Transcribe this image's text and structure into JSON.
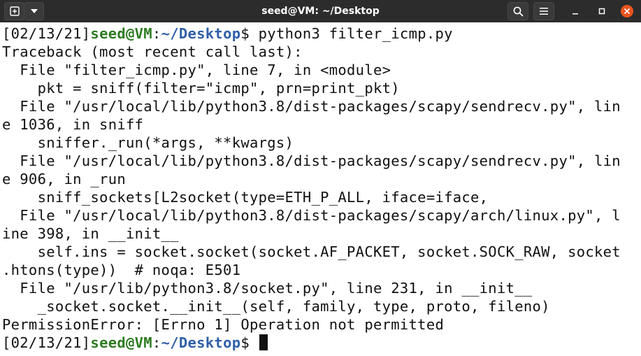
{
  "window": {
    "title": "seed@VM: ~/Desktop",
    "icons": {
      "new_tab": "new-tab-icon",
      "menu_dropdown": "chevron-down-icon",
      "search": "search-icon",
      "hamburger": "hamburger-menu-icon",
      "minimize": "minimize-icon",
      "maximize": "maximize-icon",
      "close": "close-icon"
    }
  },
  "prompt": {
    "date": "[02/13/21]",
    "user_host": "seed@VM",
    "separator": ":",
    "path": "~/Desktop",
    "symbol": "$ "
  },
  "terminal": {
    "command": "python3 filter_icmp.py",
    "output_lines": [
      "Traceback (most recent call last):",
      "  File \"filter_icmp.py\", line 7, in <module>",
      "    pkt = sniff(filter=\"icmp\", prn=print_pkt)",
      "  File \"/usr/local/lib/python3.8/dist-packages/scapy/sendrecv.py\", lin",
      "e 1036, in sniff",
      "    sniffer._run(*args, **kwargs)",
      "  File \"/usr/local/lib/python3.8/dist-packages/scapy/sendrecv.py\", lin",
      "e 906, in _run",
      "    sniff_sockets[L2socket(type=ETH_P_ALL, iface=iface,",
      "  File \"/usr/local/lib/python3.8/dist-packages/scapy/arch/linux.py\", l",
      "ine 398, in __init__",
      "    self.ins = socket.socket(socket.AF_PACKET, socket.SOCK_RAW, socket",
      ".htons(type))  # noqa: E501",
      "  File \"/usr/lib/python3.8/socket.py\", line 231, in __init__",
      "    _socket.socket.__init__(self, family, type, proto, fileno)",
      "PermissionError: [Errno 1] Operation not permitted"
    ]
  },
  "colors": {
    "titlebar_bg": "#2c2c2c",
    "terminal_bg": "#ffffff",
    "text": "#111111",
    "prompt_user": "#2f7c22",
    "prompt_path": "#2f5fa8"
  }
}
